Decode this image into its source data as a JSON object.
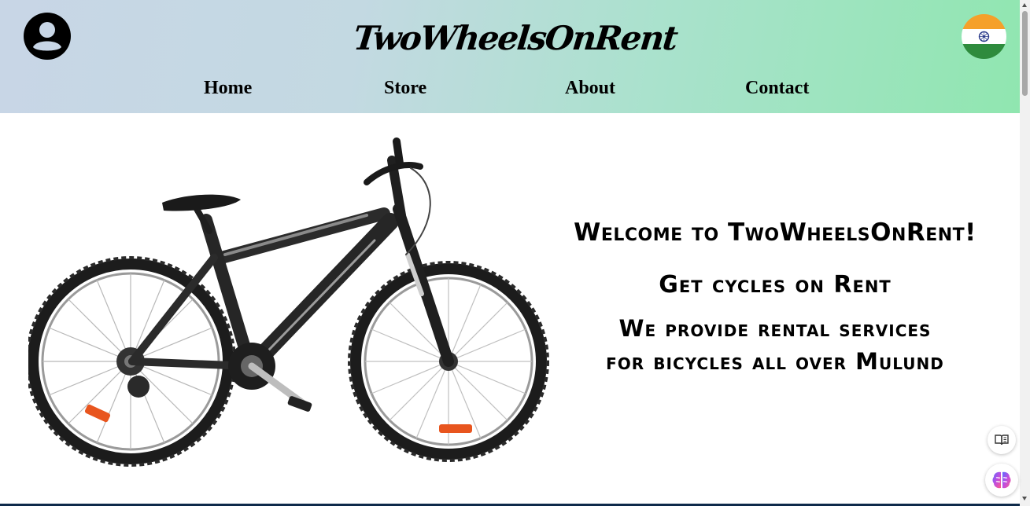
{
  "header": {
    "brand": "TwoWheelsOnRent",
    "avatar_icon": "account-circle-icon",
    "flag_icon": "india-flag-icon",
    "gradient_colors": [
      "#c8d6e6",
      "#90e6b0"
    ]
  },
  "nav": {
    "items": [
      {
        "label": "Home"
      },
      {
        "label": "Store"
      },
      {
        "label": "About"
      },
      {
        "label": "Contact"
      }
    ]
  },
  "hero": {
    "image": "mountain-bicycle-image",
    "title": "Welcome to TwoWheelsOnRent!",
    "subtitle": "Get cycles on Rent",
    "description_line1": "We provide rental services",
    "description_line2": "for bicycles all over Mulund"
  },
  "floating": {
    "reader_icon": "reading-mode-icon",
    "ai_icon": "ai-brain-icon"
  }
}
